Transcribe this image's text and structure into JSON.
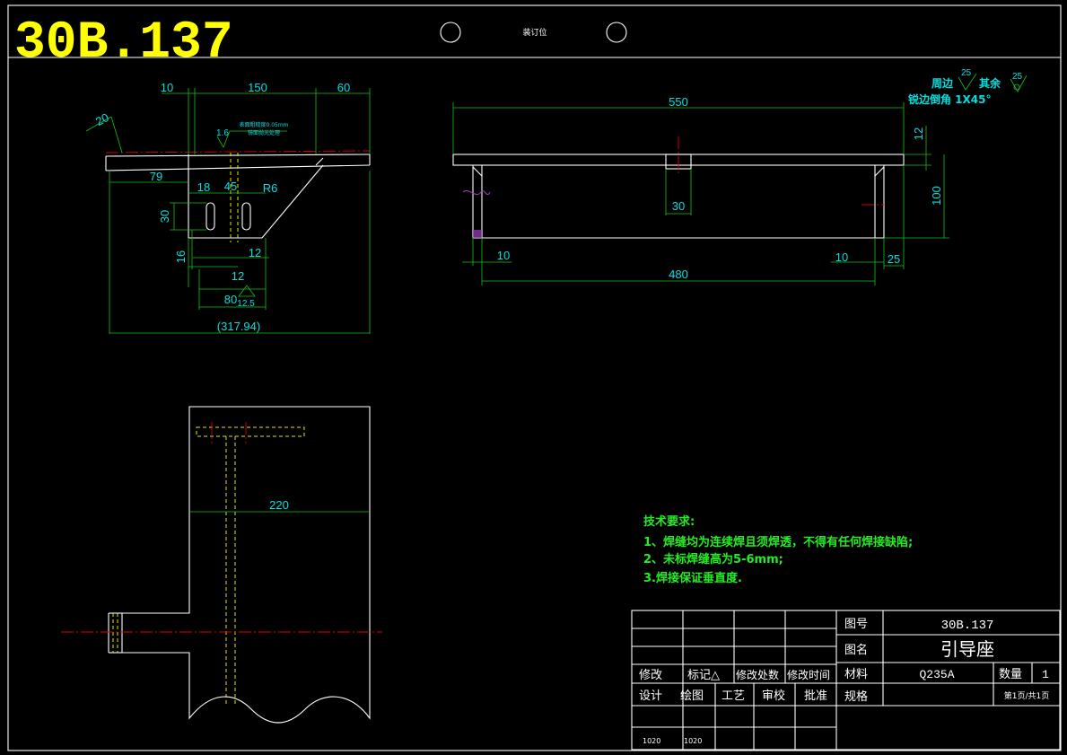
{
  "header": {
    "drawing_code": "30B.137",
    "binding_label": "装订位"
  },
  "front_view": {
    "dims": {
      "d10": "10",
      "d150": "150",
      "d60": "60",
      "d20": "20",
      "d79": "79",
      "d18": "18",
      "d45": "45",
      "r6": "R6",
      "d30": "30",
      "d16": "16",
      "d12a": "12",
      "d12b": "12",
      "d80": "80",
      "d12_5": "12.5",
      "d1_6": "1.6",
      "overall": "(317.94)"
    },
    "note_line1": "表面粗糙度0.05mm",
    "note_line2": "镜面抛光处理"
  },
  "top_view": {
    "dims": {
      "d550": "550",
      "d12": "12",
      "d100": "100",
      "d30": "30",
      "d10a": "10",
      "d10b": "10",
      "d25": "25",
      "d480": "480"
    }
  },
  "surface_note": {
    "periphery_label": "周边",
    "periphery_value": "25",
    "rest_label": "其余",
    "rest_value": "25",
    "chamfer": "锐边倒角 1X45°"
  },
  "side_view": {
    "dims": {
      "d220": "220"
    }
  },
  "tech_requirements": {
    "title": "技术要求:",
    "items": [
      "1、焊缝均为连续焊且须焊透，不得有任何焊接缺陷;",
      "2、未标焊缝高为5-6mm;",
      "3.焊接保证垂直度."
    ]
  },
  "title_block": {
    "revision_labels": [
      "修改",
      "标记△",
      "修改处数",
      "修改时间"
    ],
    "sign_labels": [
      "设计",
      "绘图",
      "工艺",
      "审校",
      "批准"
    ],
    "sign_values": [
      "1020",
      "1020"
    ],
    "drawing_no_label": "图号",
    "drawing_no": "30B.137",
    "name_label": "图名",
    "name": "引导座",
    "material_label": "材料",
    "material": "Q235A",
    "qty_label": "数量",
    "qty": "1",
    "spec_label": "规格",
    "page": "第1页/共1页"
  }
}
